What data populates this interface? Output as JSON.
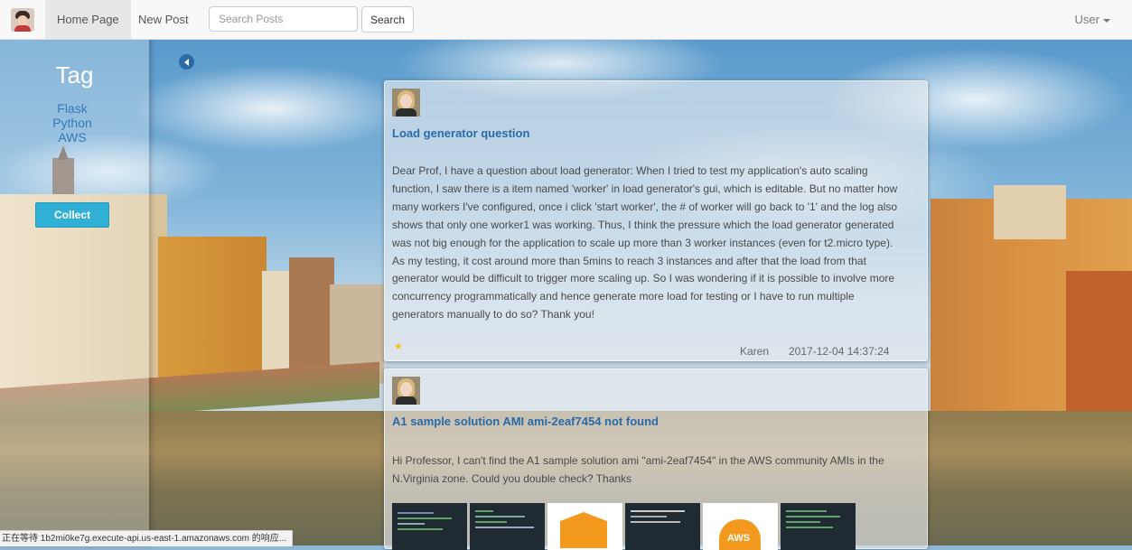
{
  "navbar": {
    "home_label": "Home Page",
    "new_post_label": "New Post",
    "search_placeholder": "Search Posts",
    "search_button": "Search",
    "user_label": "User"
  },
  "sidebar": {
    "title": "Tag",
    "tags": [
      "Flask",
      "Python",
      "AWS"
    ],
    "collect_label": "Collect"
  },
  "posts": [
    {
      "title": "Load generator question",
      "body": "Dear Prof, I have a question about load generator: When I tried to test my application's auto scaling function, I saw there is a item named 'worker' in load generator's gui, which is editable. But no matter how many workers I've configured, once i click 'start worker', the # of worker will go back to '1' and the log also shows that only one worker1 was working. Thus, I think the pressure which the load generator generated was not big enough for the application to scale up more than 3 worker instances (even for t2.micro type). As my testing, it cost around more than 5mins to reach 3 instances and after that the load from that generator would be difficult to trigger more scaling up. So I was wondering if it is possible to involve more concurrency programmatically and hence generate more load for testing or I have to run multiple generators manually to do so? Thank you!",
      "author": "Karen",
      "timestamp": "2017-12-04 14:37:24",
      "starred": true
    },
    {
      "title": "A1 sample solution AMI ami-2eaf7454 not found",
      "body": "Hi Professor, I can't find the A1 sample solution ami \"ami-2eaf7454\" in the AWS community AMIs in the N.Virginia zone. Could you double check? Thanks",
      "attachments_count": 6
    }
  ],
  "status_bar": {
    "text": "正在等待 1b2mi0ke7g.execute-api.us-east-1.amazonaws.com 的响应..."
  },
  "colors": {
    "link": "#337ab7",
    "title": "#2a6aa8",
    "collect_button": "#31b0d5",
    "navbar": "#f8f8f8"
  },
  "icons": {
    "toggle": "chevron-left-icon",
    "star": "star-icon",
    "user_caret": "caret-down-icon"
  }
}
